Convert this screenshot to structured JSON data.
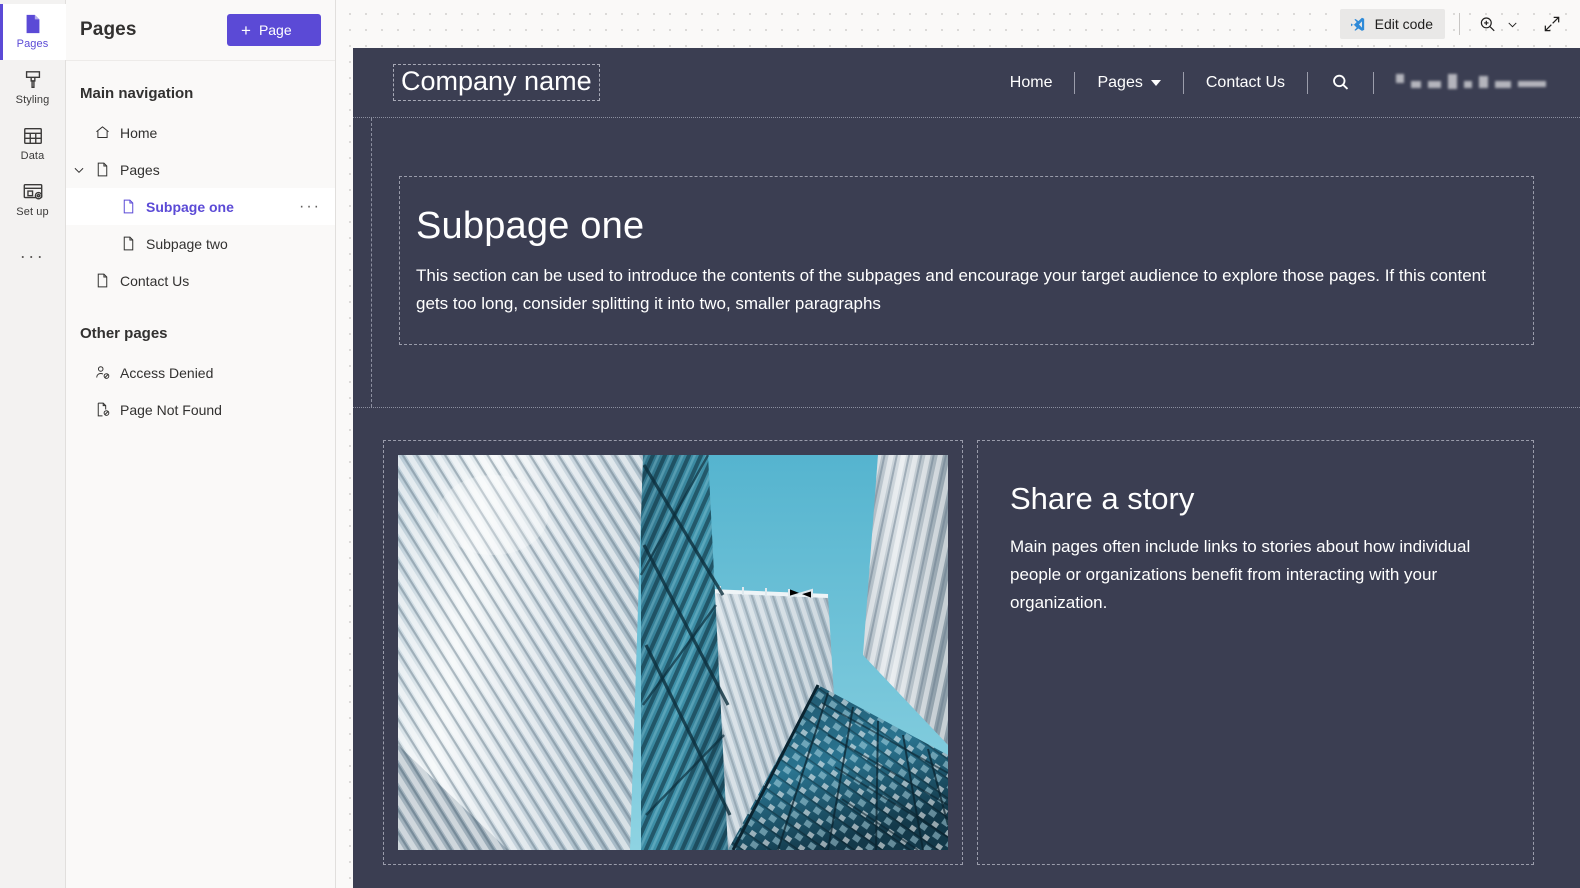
{
  "rail": {
    "items": [
      {
        "label": "Pages",
        "icon": "page-icon",
        "active": true
      },
      {
        "label": "Styling",
        "icon": "brush-icon",
        "active": false
      },
      {
        "label": "Data",
        "icon": "table-icon",
        "active": false
      },
      {
        "label": "Set up",
        "icon": "setup-icon",
        "active": false
      }
    ],
    "more_label": "···"
  },
  "panel": {
    "title": "Pages",
    "add_button": {
      "label": "Page",
      "plus": "+"
    },
    "main_nav_heading": "Main navigation",
    "other_heading": "Other pages",
    "main_nav": [
      {
        "label": "Home",
        "icon": "home-icon",
        "level": 0,
        "expandable": false,
        "selected": false
      },
      {
        "label": "Pages",
        "icon": "page-icon",
        "level": 0,
        "expandable": true,
        "expanded": true,
        "selected": false
      },
      {
        "label": "Subpage one",
        "icon": "page-icon",
        "level": 1,
        "expandable": false,
        "selected": true,
        "overflow": "···"
      },
      {
        "label": "Subpage two",
        "icon": "page-icon",
        "level": 1,
        "expandable": false,
        "selected": false
      },
      {
        "label": "Contact Us",
        "icon": "page-icon",
        "level": 0,
        "expandable": false,
        "selected": false
      }
    ],
    "other_pages": [
      {
        "label": "Access Denied",
        "icon": "person-blocked-icon"
      },
      {
        "label": "Page Not Found",
        "icon": "page-blocked-icon"
      }
    ]
  },
  "canvas_toolbar": {
    "edit_code_label": "Edit code",
    "edit_code_icon": "vscode-icon",
    "zoom_icon": "zoom-in-icon",
    "zoom_chevron_icon": "chevron-down-icon",
    "expand_icon": "expand-diagonal-icon"
  },
  "site": {
    "brand": "Company name",
    "nav": [
      {
        "label": "Home",
        "type": "link"
      },
      {
        "label": "Pages",
        "type": "dropdown",
        "caret_icon": "caret-down-icon"
      },
      {
        "label": "Contact Us",
        "type": "link"
      }
    ],
    "search_icon": "search-icon",
    "redacted_label": "",
    "sections": {
      "hero": {
        "heading": "Subpage one",
        "paragraph": "This section can be used to introduce the contents of the subpages and encourage your target audience to explore those pages. If this content gets too long, consider splitting it into two, smaller paragraphs"
      },
      "story": {
        "heading": "Share a story",
        "paragraph": "Main pages often include links to stories about how individual people or organizations benefit from interacting with your organization.",
        "image_alt": "low-angle photo of modern glass skyscrapers against blue sky"
      }
    }
  },
  "colors": {
    "accent_purple": "#5b4ad6",
    "site_background": "#3b3e52",
    "panel_background": "#faf9f8",
    "rail_background": "#f3f2f1"
  }
}
